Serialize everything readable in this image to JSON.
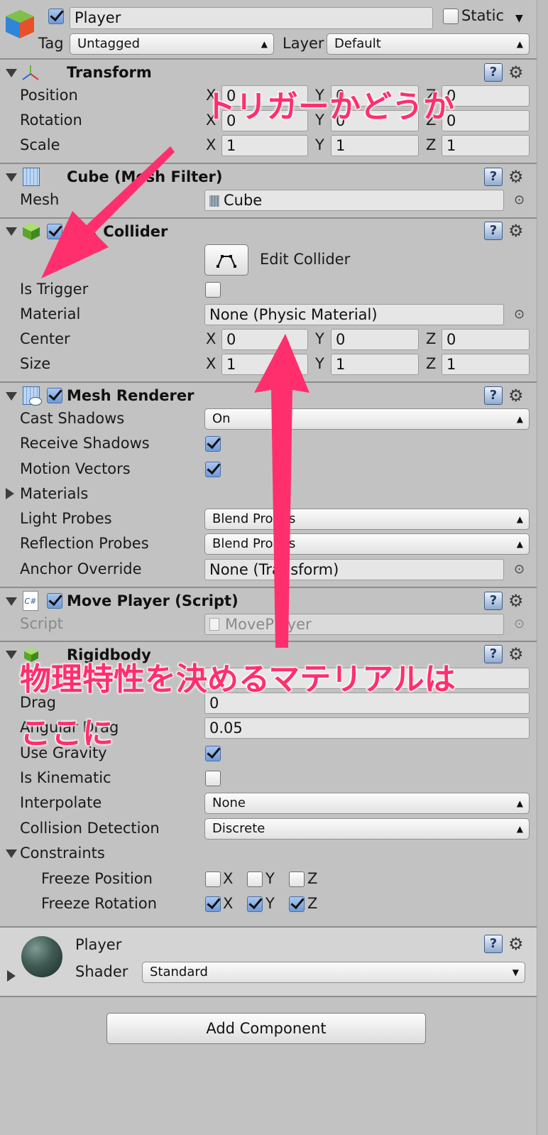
{
  "header": {
    "object_name": "Player",
    "static_label": "Static",
    "tag_label": "Tag",
    "tag_value": "Untagged",
    "layer_label": "Layer",
    "layer_value": "Default"
  },
  "transform": {
    "title": "Transform",
    "position_label": "Position",
    "rotation_label": "Rotation",
    "scale_label": "Scale",
    "position": {
      "x": "0",
      "y": "0",
      "z": "0"
    },
    "rotation": {
      "x": "0",
      "y": "0",
      "z": "0"
    },
    "scale": {
      "x": "1",
      "y": "1",
      "z": "1"
    }
  },
  "axis": {
    "x": "X",
    "y": "Y",
    "z": "Z"
  },
  "mesh_filter": {
    "title": "Cube (Mesh Filter)",
    "mesh_label": "Mesh",
    "mesh_value": "Cube"
  },
  "box_collider": {
    "title": "Box Collider",
    "edit_collider": "Edit Collider",
    "is_trigger_label": "Is Trigger",
    "material_label": "Material",
    "material_value": "None (Physic Material)",
    "center_label": "Center",
    "size_label": "Size",
    "center": {
      "x": "0",
      "y": "0",
      "z": "0"
    },
    "size": {
      "x": "1",
      "y": "1",
      "z": "1"
    }
  },
  "mesh_renderer": {
    "title": "Mesh Renderer",
    "cast_shadows_label": "Cast Shadows",
    "cast_shadows_value": "On",
    "receive_shadows_label": "Receive Shadows",
    "motion_vectors_label": "Motion Vectors",
    "materials_label": "Materials",
    "light_probes_label": "Light Probes",
    "light_probes_value": "Blend Probes",
    "reflection_probes_label": "Reflection Probes",
    "reflection_probes_value": "Blend Probes",
    "anchor_override_label": "Anchor Override",
    "anchor_override_value": "None (Transform)"
  },
  "move_player": {
    "title": "Move Player (Script)",
    "script_label": "Script",
    "script_value": "MovePlayer"
  },
  "rigidbody": {
    "title": "Rigidbody",
    "drag_label": "Drag",
    "drag_value": "0",
    "angular_drag_label": "Angular Drag",
    "angular_drag_value": "0.05",
    "use_gravity_label": "Use Gravity",
    "is_kinematic_label": "Is Kinematic",
    "interpolate_label": "Interpolate",
    "interpolate_value": "None",
    "collision_label": "Collision Detection",
    "collision_value": "Discrete",
    "constraints_label": "Constraints",
    "freeze_position_label": "Freeze Position",
    "freeze_rotation_label": "Freeze Rotation"
  },
  "material_panel": {
    "name": "Player",
    "shader_label": "Shader",
    "shader_value": "Standard"
  },
  "add_component": "Add Component",
  "annotations": {
    "trigger_note": "トリガーかどうか",
    "material_note_line1": "物理特性を決めるマテリアルは",
    "material_note_line2": "ここに"
  },
  "colors": {
    "annotation": "#ff2f6e",
    "panel": "#c2c2c2",
    "accent": "#6f9bd8"
  },
  "icons": [
    "gameobject-cube-icon",
    "transform-icon",
    "mesh-filter-icon",
    "box-collider-icon",
    "mesh-renderer-icon",
    "script-icon",
    "rigidbody-icon",
    "material-sphere-icon",
    "help-icon",
    "gear-icon",
    "object-picker-icon"
  ]
}
